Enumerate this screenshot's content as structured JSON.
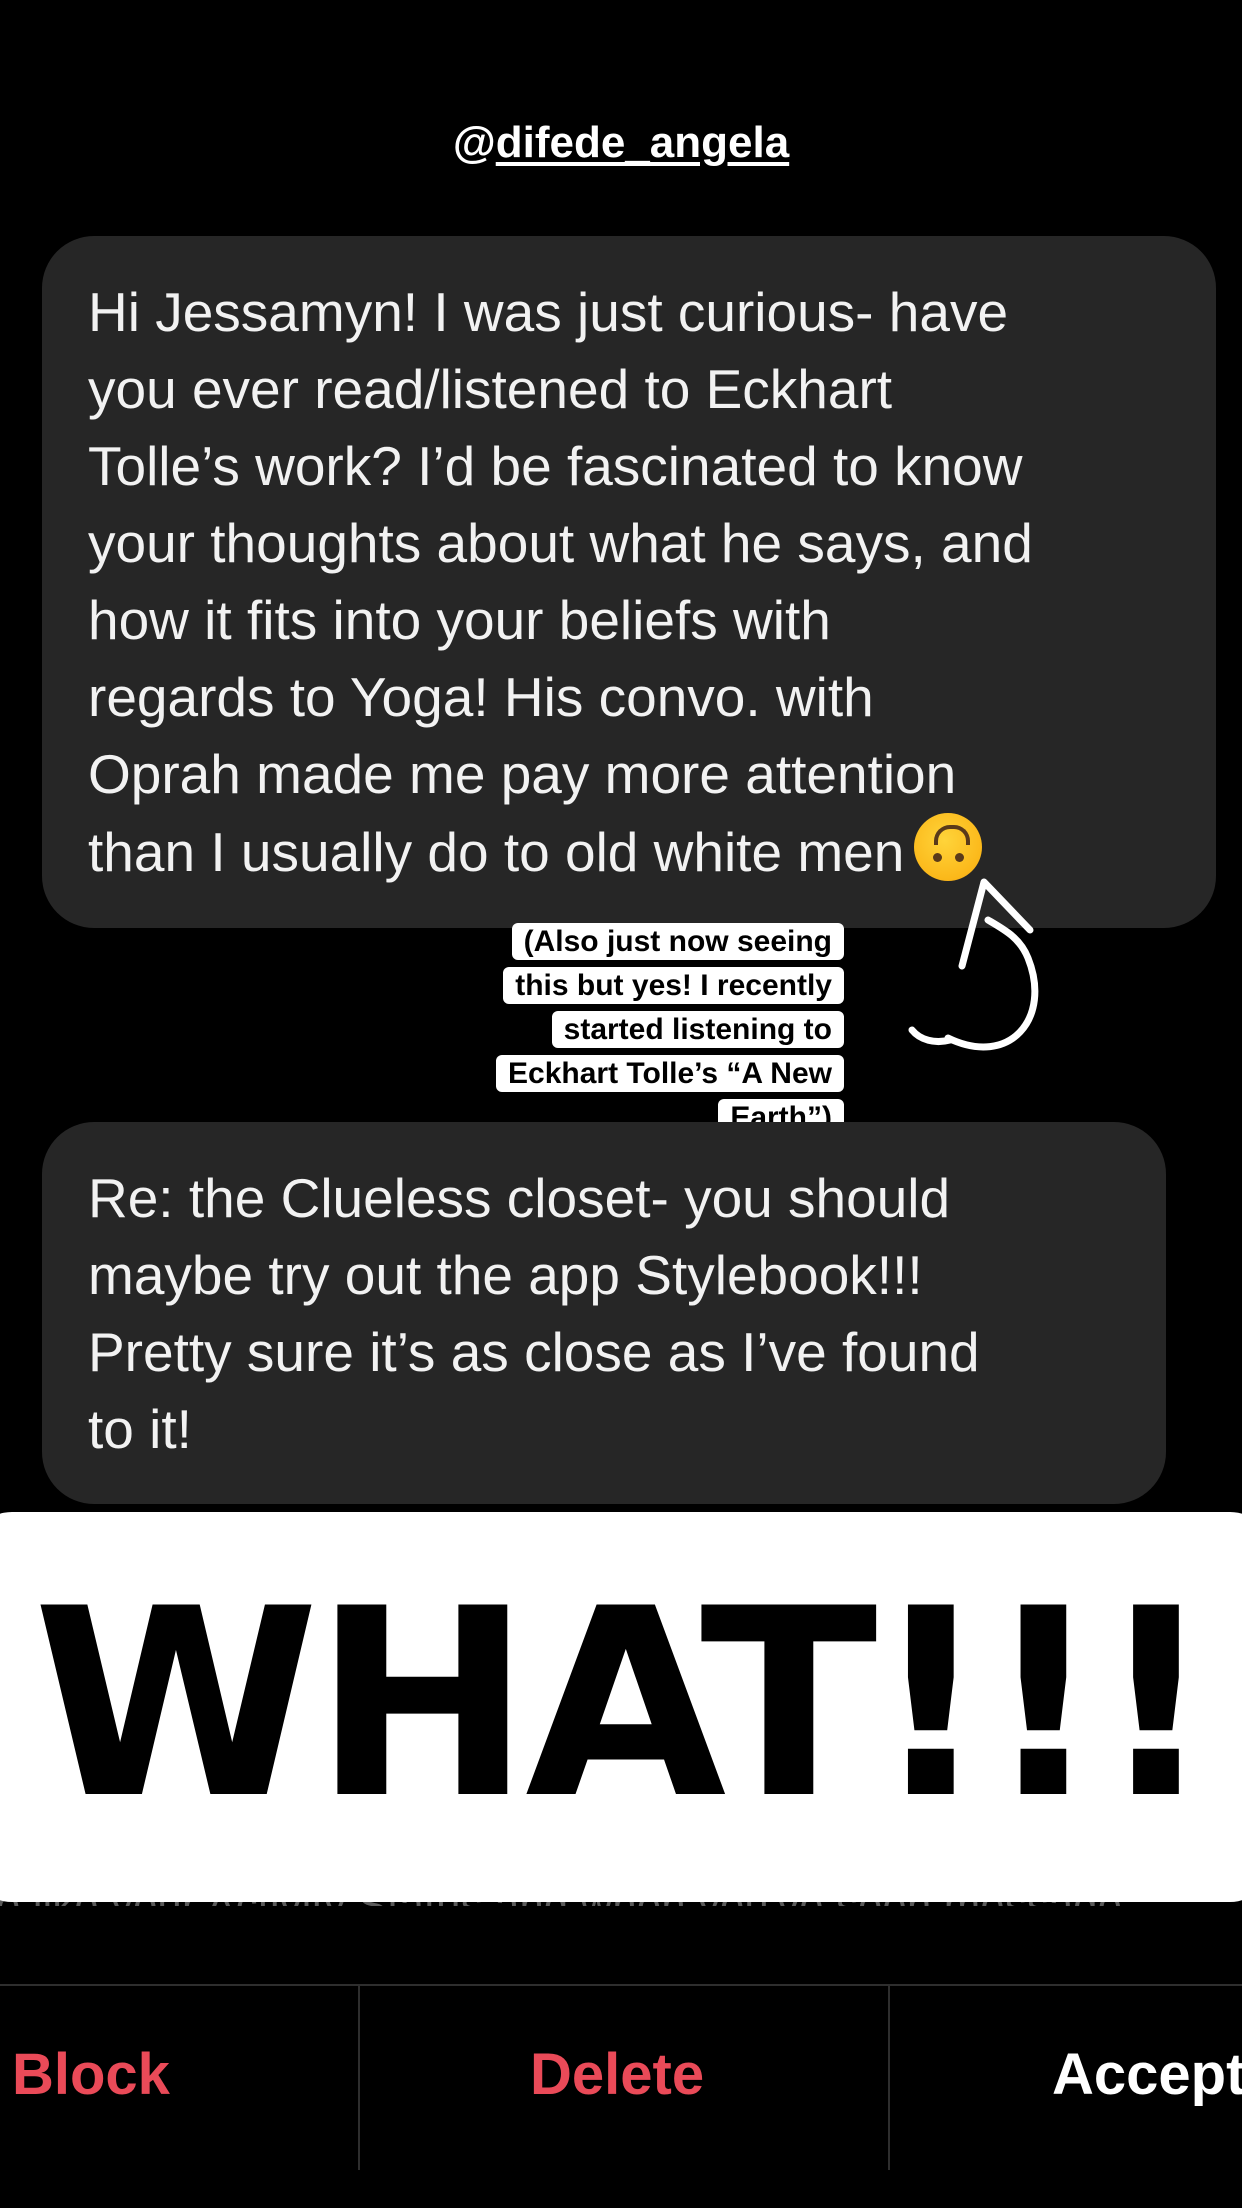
{
  "header": {
    "at": "@",
    "handle": "difede_angela"
  },
  "messages": [
    {
      "lines": [
        "Hi Jessamyn! I was just curious- have",
        "you ever read/listened to Eckhart",
        "Tolle’s work? I’d be fascinated to know",
        "your thoughts about what he says, and",
        "how it fits into your beliefs with",
        "regards to Yoga! His convo. with",
        "Oprah made me pay more attention",
        "than I usually do to old white men"
      ],
      "emoji": "upside-down-face-emoji"
    },
    {
      "lines": [
        "Re: the Clueless closet- you should",
        "maybe try out the app Stylebook!!!",
        "Pretty sure it’s as close as I’ve found",
        "to it!"
      ]
    }
  ],
  "sticker_text": {
    "lines": [
      "(Also just now seeing",
      "this but yes! I recently",
      "started listening to",
      "Eckhart Tolle’s “A New",
      "Earth”)"
    ]
  },
  "overlay_text": "WHAT!!!",
  "obscured_text": "e like your Activity Status and when you've seen message",
  "actions": {
    "block": "Block",
    "delete": "Delete",
    "accept": "Accept"
  },
  "colors": {
    "background": "#000000",
    "bubble": "#262626",
    "destructive": "#ea4a58",
    "overlay_card": "#ffffff"
  }
}
